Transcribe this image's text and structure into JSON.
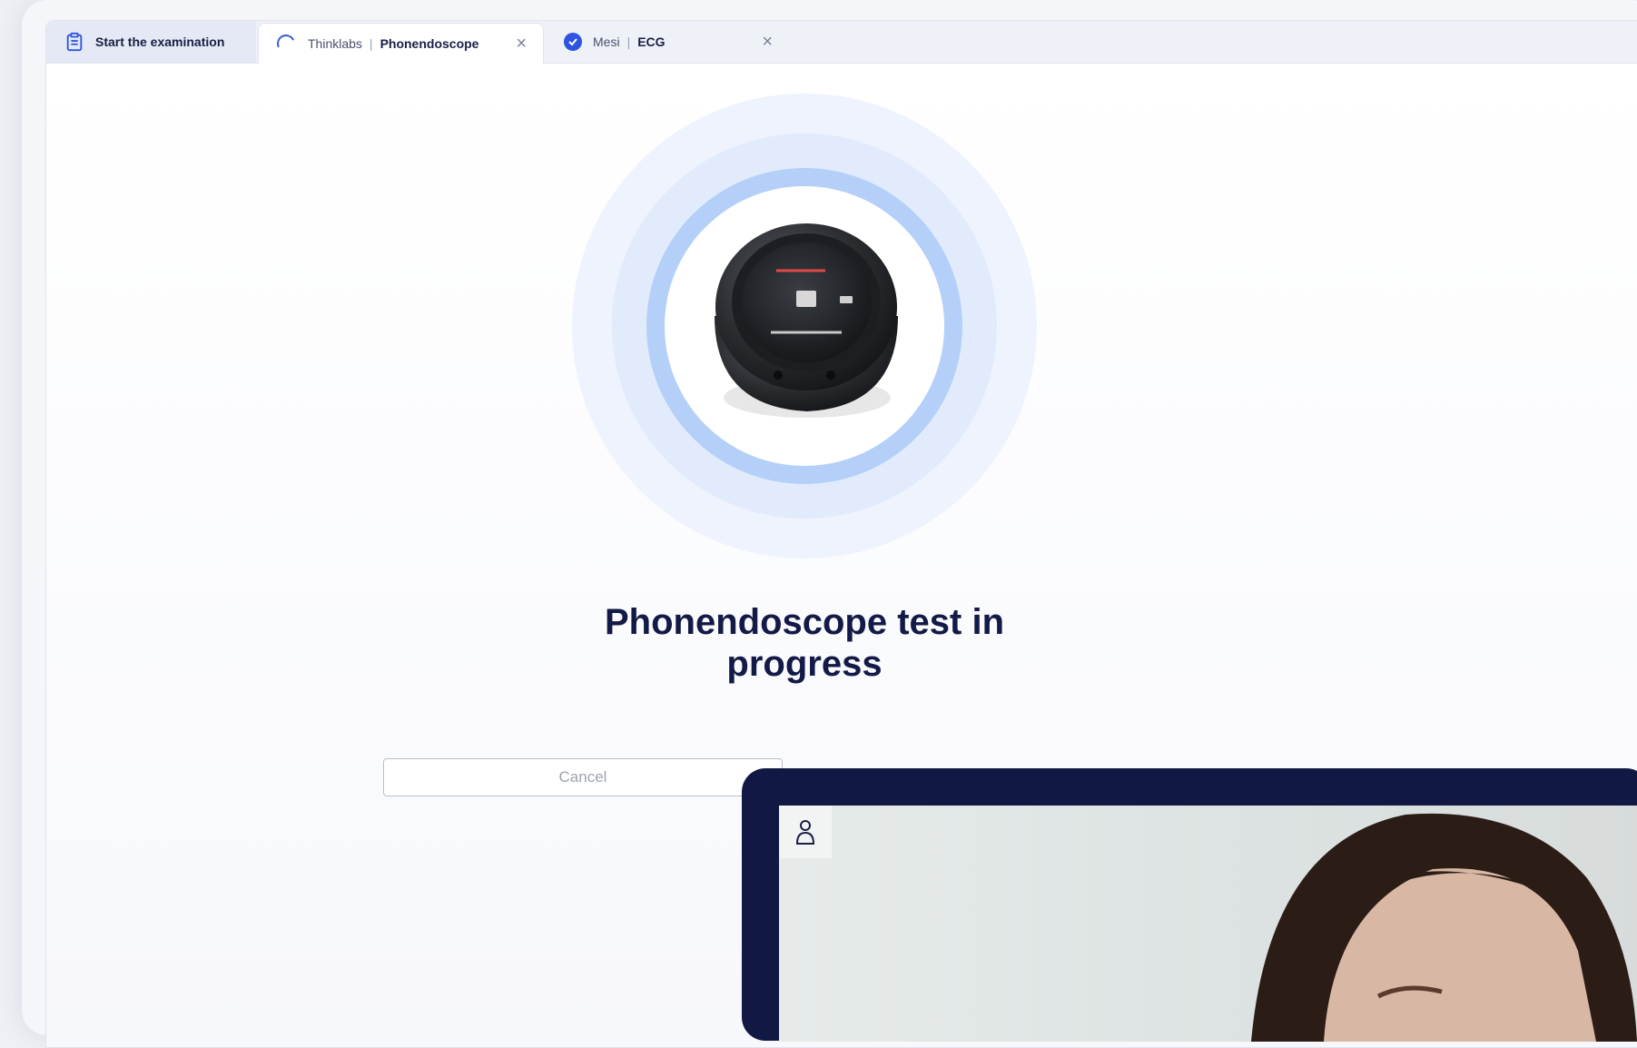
{
  "tabs": [
    {
      "label_bold": "Start the examination",
      "icon": "clipboard-icon"
    },
    {
      "label": "Thinklabs",
      "separator": "|",
      "label_bold": "Phonendoscope",
      "icon": "spinner-icon",
      "close": "×"
    },
    {
      "label": "Mesi",
      "separator": "|",
      "label_bold": "ECG",
      "icon": "check-circle-icon",
      "close": "×"
    }
  ],
  "main": {
    "heading": "Phonendoscope test in progress",
    "cancel_label": "Cancel"
  },
  "video": {
    "user_icon": "user-icon"
  },
  "colors": {
    "accent": "#2d55e0",
    "heading": "#141a47",
    "ring_inner": "#b4d0f8",
    "video_frame": "#111843"
  }
}
